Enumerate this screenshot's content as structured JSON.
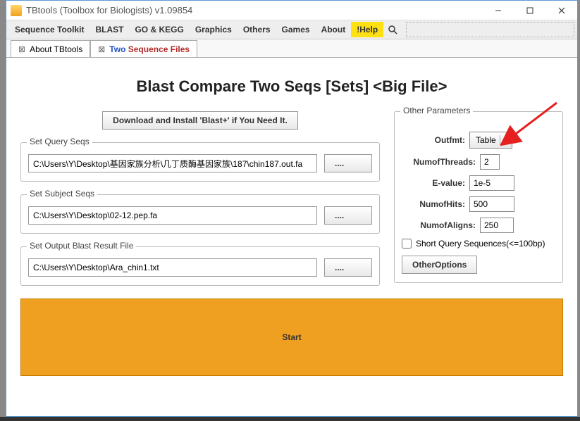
{
  "window": {
    "title": "TBtools (Toolbox for Biologists) v1.09854"
  },
  "menubar": {
    "items": [
      "Sequence Toolkit",
      "BLAST",
      "GO & KEGG",
      "Graphics",
      "Others",
      "Games",
      "About"
    ],
    "help": "!Help"
  },
  "tabs": {
    "about": "About TBtools",
    "active_prefix": "Two",
    "active_rest": " Sequence Files"
  },
  "page": {
    "heading": "Blast Compare Two Seqs [Sets] <Big File>",
    "download_btn": "Download and Install 'Blast+' if You Need It.",
    "query_legend": "Set Query Seqs",
    "query_path": "C:\\Users\\Y\\Desktop\\基因家族分析\\几丁质酶基因家族\\187\\chin187.out.fa",
    "subject_legend": "Set Subject Seqs",
    "subject_path": "C:\\Users\\Y\\Desktop\\02-12.pep.fa",
    "output_legend": "Set Output Blast Result File",
    "output_path": "C:\\Users\\Y\\Desktop\\Ara_chin1.txt",
    "browse": "....",
    "start": "Start"
  },
  "params": {
    "legend": "Other Parameters",
    "outfmt_label": "Outfmt:",
    "outfmt_value": "Table",
    "threads_label": "NumofThreads:",
    "threads_value": "2",
    "evalue_label": "E-value:",
    "evalue_value": "1e-5",
    "hits_label": "NumofHits:",
    "hits_value": "500",
    "aligns_label": "NumofAligns:",
    "aligns_value": "250",
    "shortq_label": "Short Query Sequences(<=100bp)",
    "other_btn": "OtherOptions"
  }
}
